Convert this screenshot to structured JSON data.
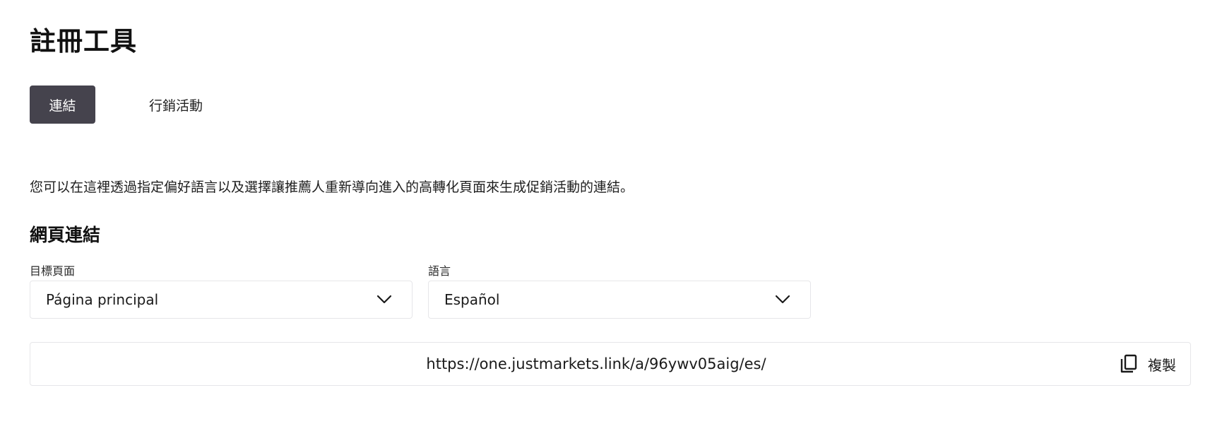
{
  "page": {
    "title": "註冊工具"
  },
  "tabs": [
    {
      "label": "連結",
      "active": true
    },
    {
      "label": "行銷活動",
      "active": false
    }
  ],
  "description": "您可以在這裡透過指定偏好語言以及選擇讓推薦人重新導向進入的高轉化頁面來生成促銷活動的連結。",
  "web_link": {
    "section_title": "網頁連結",
    "target_page": {
      "label": "目標頁面",
      "value": "Página principal"
    },
    "language": {
      "label": "語言",
      "value": "Español"
    },
    "url": "https://one.justmarkets.link/a/96ywv05aig/es/",
    "copy_label": "複製"
  },
  "icons": {
    "dropdown": "chevron-down-icon",
    "copy": "copy-icon"
  },
  "colors": {
    "active_tab_bg": "#45434d",
    "border": "#e6e6e9",
    "text": "#1a1a1a"
  }
}
